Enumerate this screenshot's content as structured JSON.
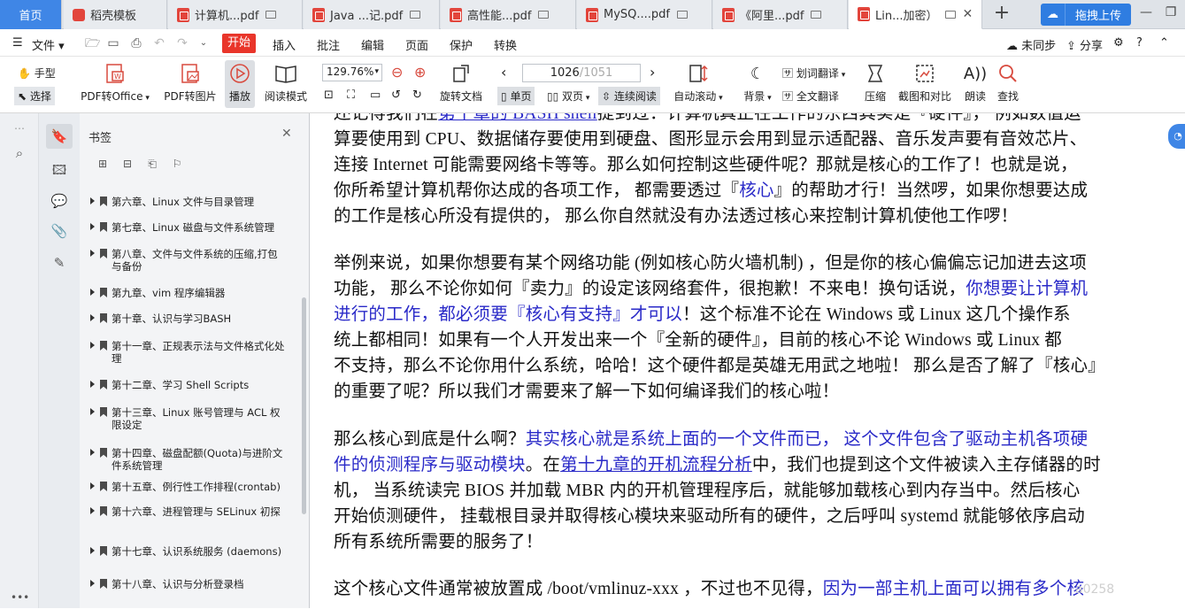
{
  "tabs": [
    {
      "label": "首页"
    },
    {
      "label": "稻壳模板"
    },
    {
      "label": "计算机...pdf"
    },
    {
      "label": "Java ...记.pdf"
    },
    {
      "label": "高性能...pdf"
    },
    {
      "label": "MySQ....pdf"
    },
    {
      "label": "《阿里...pdf"
    },
    {
      "label": "Lin...加密）"
    }
  ],
  "upload_label": "拖拽上传",
  "menu": {
    "file": "文件",
    "start": "开始",
    "items": [
      "插入",
      "批注",
      "编辑",
      "页面",
      "保护",
      "转换"
    ],
    "sync": "未同步",
    "share": "分享"
  },
  "toolbar": {
    "hand": "手型",
    "select": "选择",
    "pdf_to_office": "PDF转Office",
    "pdf_to_image": "PDF转图片",
    "play": "播放",
    "read_mode": "阅读模式",
    "zoom": "129.76%",
    "rotate": "旋转文档",
    "page_current": "1026",
    "page_total": "/1051",
    "single": "单页",
    "double": "双页",
    "continuous": "连续阅读",
    "autoscroll": "自动滚动",
    "background": "背景",
    "word_translate": "划词翻译",
    "full_translate": "全文翻译",
    "compress": "压缩",
    "screenshot": "截图和对比",
    "read_aloud": "朗读",
    "search": "查找"
  },
  "bookmarks": {
    "title": "书签",
    "items": [
      "第六章、Linux 文件与目录管理",
      "第七章、Linux 磁盘与文件系统管理",
      "第八章、文件与文件系统的压缩,打包与备份",
      "第九章、vim 程序编辑器",
      "第十章、认识与学习BASH",
      "第十一章、正规表示法与文件格式化处理",
      "第十二章、学习 Shell Scripts",
      "第十三章、Linux 账号管理与 ACL 权限设定",
      "第十四章、磁盘配额(Quota)与进阶文件系统管理",
      "第十五章、例行性工作排程(crontab)",
      "第十六章、进程管理与 SELinux 初探",
      "第十七章、认识系统服务 (daemons)",
      "第十八章、认识与分析登录档"
    ]
  },
  "doc": {
    "p0a": "还记得我们在",
    "p0link": "第十章的 BASH shell",
    "p0b": "提到过：计算机真正在工作的东西其实是『硬件』， 例如数值运",
    "p1": "算要使用到 CPU、数据储存要使用到硬盘、图形显示会用到显示适配器、音乐发声要有音效芯片、",
    "p2": "连接 Internet 可能需要网络卡等等。那么如何控制这些硬件呢？那就是核心的工作了！也就是说，",
    "p3a": "你所希望计算机帮你达成的各项工作， 都需要透过『",
    "p3b": "核心",
    "p3c": "』的帮助才行！当然啰，如果你想要达成",
    "p4": "的工作是核心所没有提供的， 那么你自然就没有办法透过核心来控制计算机使他工作啰！",
    "q1": "举例来说，如果你想要有某个网络功能 (例如核心防火墙机制) ，但是你的核心偏偏忘记加进去这项",
    "q2a": "功能， 那么不论你如何『卖力』的设定该网络套件，很抱歉！不来电！换句话说，",
    "q2b": "你想要让计算机",
    "q3a": "进行的工作，都必须要『核心有支持』才可以",
    "q3b": "！这个标准不论在 Windows 或 Linux 这几个操作系",
    "q4": "统上都相同！如果有一个人开发出来一个『全新的硬件』，目前的核心不论 Windows 或 Linux 都",
    "q5": "不支持，那么不论你用什么系统，哈哈！这个硬件都是英雄无用武之地啦！ 那么是否了解了『核心』",
    "q6": "的重要了呢？所以我们才需要来了解一下如何编译我们的核心啦！",
    "r1a": "那么核心到底是什么啊？",
    "r1b": "其实核心就是系统上面的一个文件而已， 这个文件包含了驱动主机各项硬",
    "r2a": "件的侦测程序与驱动模块",
    "r2b": "。在",
    "r2link": "第十九章的开机流程分析",
    "r2c": "中，我们也提到这个文件被读入主存储器的时",
    "r3": "机， 当系统读完 BIOS 并加载 MBR 内的开机管理程序后，就能够加载核心到内存当中。然后核心",
    "r4": "开始侦测硬件， 挂载根目录并取得核心模块来驱动所有的硬件，之后呼叫 systemd 就能够依序启动",
    "r5": "所有系统所需要的服务了！",
    "s1a": "这个核心文件通常被放置成 /boot/vmlinuz-xxx ，不过也不见得，",
    "s1b": "因为一部主机上面可以拥有多个核"
  },
  "watermark": "a0258"
}
